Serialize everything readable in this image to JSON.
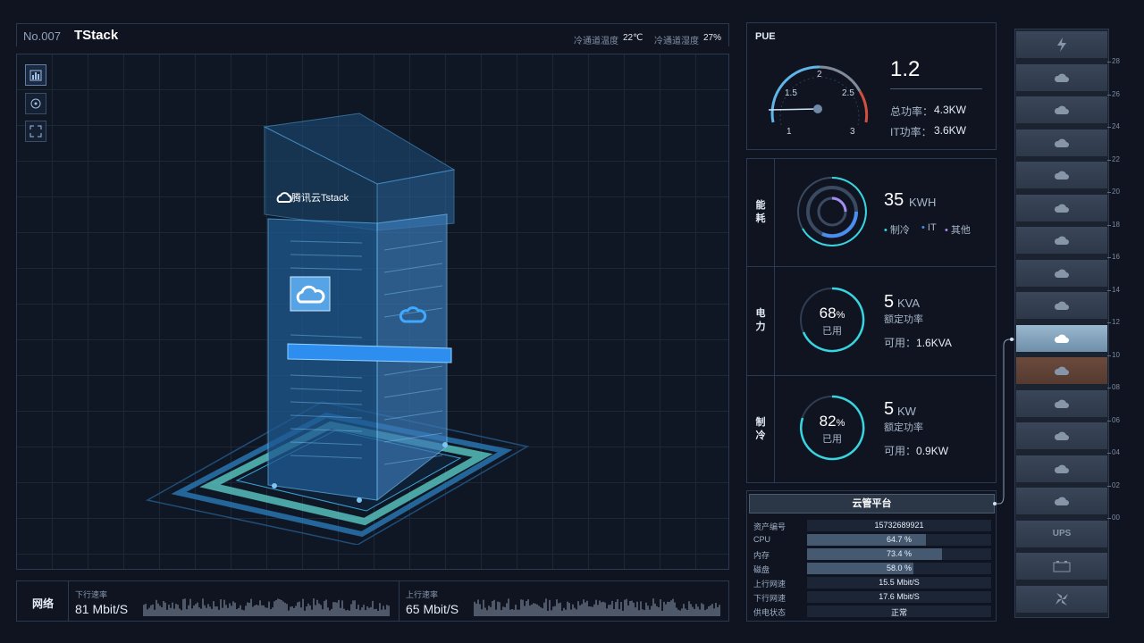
{
  "header": {
    "no": "No.007",
    "name": "TStack",
    "cold_temp_label": "冷通道温度",
    "cold_temp_value": "22℃",
    "cold_hum_label": "冷通道湿度",
    "cold_hum_value": "27%"
  },
  "cabinet": {
    "brand": "腾讯云Tstack"
  },
  "toolbar": [
    "bar-chart-icon",
    "rotate-icon",
    "fullscreen-icon"
  ],
  "network": {
    "label": "网络",
    "down_title": "下行速率",
    "down_value": "81 Mbit/S",
    "up_title": "上行速率",
    "up_value": "65 Mbit/S"
  },
  "pue": {
    "title": "PUE",
    "value": "1.2",
    "gauge_ticks": [
      "1",
      "1.5",
      "2",
      "2.5",
      "3"
    ],
    "total_label": "总功率：",
    "total_value": "4.3KW",
    "it_label": "IT功率：",
    "it_value": "3.6KW"
  },
  "energy": {
    "label": "能耗",
    "value": "35",
    "unit": "KWH",
    "legend": [
      "制冷",
      "IT",
      "其他"
    ],
    "colors": [
      "#37d5e0",
      "#4a8ff0",
      "#a48cf0"
    ]
  },
  "power": {
    "label": "电力",
    "pct": "68",
    "pct_sym": "%",
    "used": "已用",
    "value": "5",
    "unit": "KVA",
    "rated": "额定功率",
    "avail_label": "可用：",
    "avail_value": "1.6KVA"
  },
  "cooling": {
    "label": "制冷",
    "pct": "82",
    "pct_sym": "%",
    "used": "已用",
    "value": "5",
    "unit": "KW",
    "rated": "额定功率",
    "avail_label": "可用：",
    "avail_value": "0.9KW"
  },
  "cloud": {
    "title": "云管平台",
    "rows": [
      {
        "k": "资产编号",
        "v": "15732689921",
        "fill": 0
      },
      {
        "k": "CPU",
        "v": "64.7 %",
        "fill": 0.647
      },
      {
        "k": "内存",
        "v": "73.4 %",
        "fill": 0.734
      },
      {
        "k": "磁盘",
        "v": "58.0 %",
        "fill": 0.58
      },
      {
        "k": "上行网速",
        "v": "15.5 Mbit/S",
        "fill": 0
      },
      {
        "k": "下行网速",
        "v": "17.6 Mbit/S",
        "fill": 0
      },
      {
        "k": "供电状态",
        "v": "正常",
        "fill": 0
      }
    ]
  },
  "rack": {
    "ticks": [
      "28",
      "26",
      "24",
      "22",
      "20",
      "18",
      "16",
      "14",
      "12",
      "10",
      "08",
      "06",
      "04",
      "02",
      "00"
    ],
    "ups_label": "UPS"
  }
}
